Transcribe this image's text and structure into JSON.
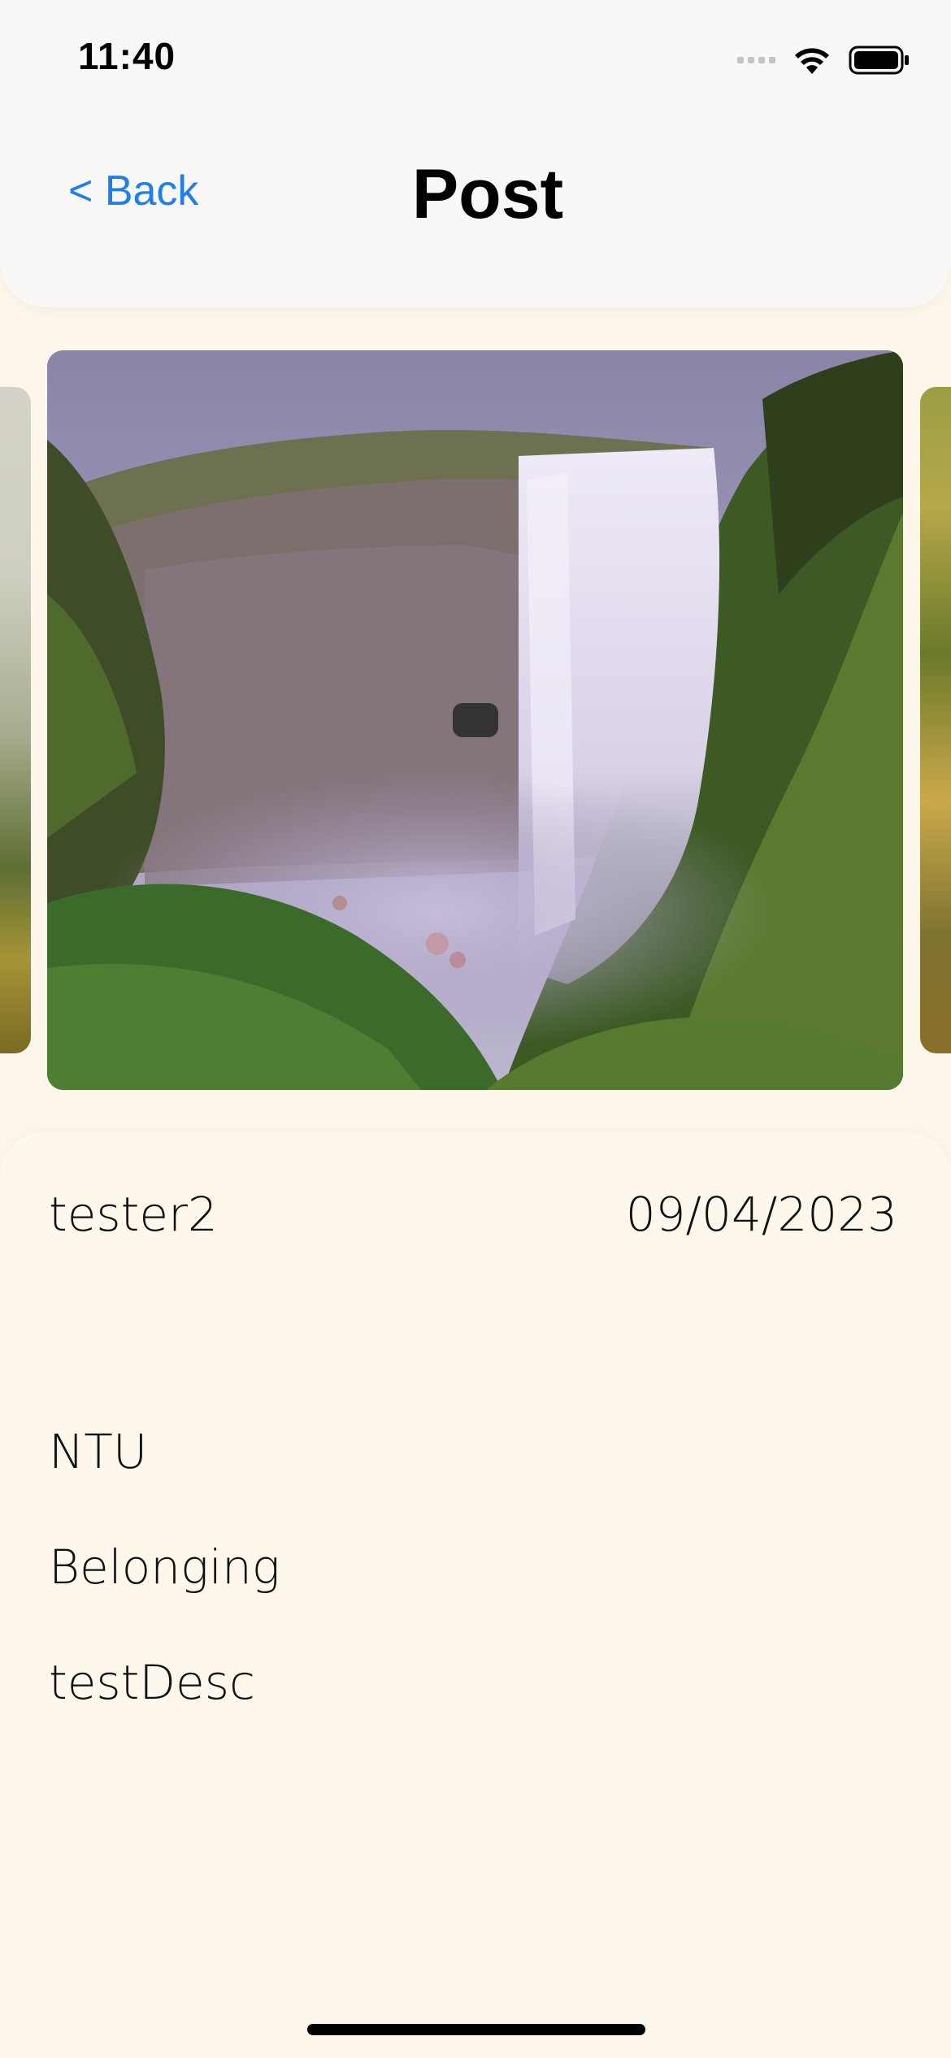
{
  "status_bar": {
    "time": "11:40",
    "icons": [
      "cellular-signal-icon",
      "wifi-icon",
      "battery-icon"
    ]
  },
  "nav": {
    "back_label": "< Back",
    "title": "Post"
  },
  "carousel": {
    "current_image": "waterfall-photo",
    "accent": "#1e7ef0"
  },
  "post": {
    "username": "tester2",
    "date": "09/04/2023",
    "organization": "NTU",
    "category": "Belonging",
    "description": "testDesc"
  }
}
